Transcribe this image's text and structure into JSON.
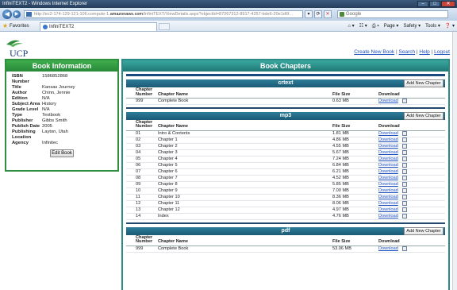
{
  "browser": {
    "title": "InfiniTEXT2 - Windows Internet Explorer",
    "url_prefix": "http://ec2-174-129-121-106.compute-1.",
    "url_domain": "amazonaws.com",
    "url_rest": "/InfiniTEXT/ViewDetails.aspx?objectId=87267312-8917-4257-bde6-20e1d6f...",
    "search_placeholder": "Google",
    "favorites_label": "Favorites",
    "tab_title": "InfiniTEXT2",
    "commands": [
      "Page ▾",
      "Safety ▾",
      "Tools ▾",
      "❓ ▾"
    ]
  },
  "header": {
    "logo_text": "UCP",
    "links": [
      "Create New Book",
      "Search",
      "Help",
      "Logout"
    ]
  },
  "book_info": {
    "title": "Book Information",
    "fields": [
      {
        "label": "ISBN Number",
        "value": "1586852868"
      },
      {
        "label": "Title",
        "value": "Kansas Journey"
      },
      {
        "label": "Author",
        "value": "Chinn, Jennie"
      },
      {
        "label": "Edition",
        "value": "N/A"
      },
      {
        "label": "Subject Area",
        "value": "History"
      },
      {
        "label": "Grade Level",
        "value": "N/A"
      },
      {
        "label": "Type",
        "value": "Textbook"
      },
      {
        "label": "Publisher",
        "value": "Gibbs Smith"
      },
      {
        "label": "Publish Date",
        "value": "2005"
      },
      {
        "label": "Publishing Location",
        "value": "Layton, Utah"
      },
      {
        "label": "Agency",
        "value": "Infinitec"
      }
    ],
    "edit_button": "Edit Book"
  },
  "chapters": {
    "title": "Book Chapters",
    "add_button": "Add New Chapter",
    "columns": [
      "Chapter Number",
      "Chapter Name",
      "File Size",
      "Download"
    ],
    "download_label": "Download",
    "sections": [
      {
        "name": "crtext",
        "rows": [
          {
            "num": "999",
            "name": "Complete Book",
            "size": "0.63 MB"
          }
        ]
      },
      {
        "name": "mp3",
        "rows": [
          {
            "num": "01",
            "name": "Intro & Contents",
            "size": "1.81 MB"
          },
          {
            "num": "02",
            "name": "Chapter 1",
            "size": "4.86 MB"
          },
          {
            "num": "03",
            "name": "Chapter 2",
            "size": "4.55 MB"
          },
          {
            "num": "04",
            "name": "Chapter 3",
            "size": "5.67 MB"
          },
          {
            "num": "05",
            "name": "Chapter 4",
            "size": "7.24 MB"
          },
          {
            "num": "06",
            "name": "Chapter 5",
            "size": "6.84 MB"
          },
          {
            "num": "07",
            "name": "Chapter 6",
            "size": "6.21 MB"
          },
          {
            "num": "08",
            "name": "Chapter 7",
            "size": "4.52 MB"
          },
          {
            "num": "09",
            "name": "Chapter 8",
            "size": "5.85 MB"
          },
          {
            "num": "10",
            "name": "Chapter 9",
            "size": "7.00 MB"
          },
          {
            "num": "11",
            "name": "Chapter 10",
            "size": "8.36 MB"
          },
          {
            "num": "12",
            "name": "Chapter 11",
            "size": "8.06 MB"
          },
          {
            "num": "13",
            "name": "Chapter 12",
            "size": "4.97 MB"
          },
          {
            "num": "14",
            "name": "Index",
            "size": "4.76 MB"
          }
        ]
      },
      {
        "name": "pdf",
        "rows": [
          {
            "num": "999",
            "name": "Complete Book",
            "size": "53.06 MB"
          }
        ]
      }
    ]
  }
}
